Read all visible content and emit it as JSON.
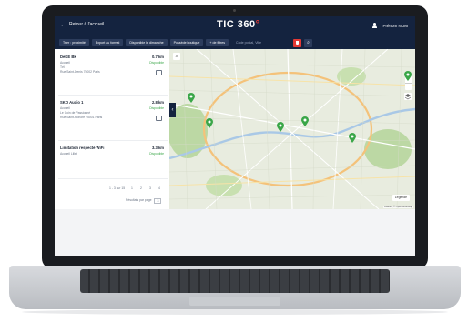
{
  "app": {
    "back_label": "Retour à l'accueil",
    "logo_main": "TIC 360",
    "logo_accent": "°",
    "user_name": "Prénom NOM"
  },
  "toolbar": {
    "buttons": [
      "Trier : proximité",
      "Export au format",
      "Disponible le dimanche",
      "Possède boutique",
      "+ de filtres"
    ],
    "search_placeholder": "Code postal, Ville"
  },
  "list": {
    "items": [
      {
        "title": "DeKE Bk",
        "distance": "0.7 km",
        "line1": "Accueil",
        "line2": "Tél",
        "line3": "Rue Saint-Denis 75002 Paris",
        "status": "Disponible"
      },
      {
        "title": "SKO Audio 1",
        "distance": "2.8 km",
        "line1": "Accueil",
        "line2": "Le Coin de Passionné",
        "line3": "Rue Saint-Honoré 75001 Paris",
        "status": "Disponible"
      },
      {
        "title": "Limitation respecté WiFi",
        "distance": "3.3 km",
        "line1": "Accueil Lillet",
        "line2": "",
        "line3": "",
        "status": "Disponible"
      }
    ],
    "pager_info": "1 - 3 sur 15",
    "pages": [
      "1",
      "2",
      "3",
      "4"
    ],
    "per_page_label": "Résultats par page",
    "per_page_value": "3"
  },
  "map": {
    "legend_label": "Légende",
    "attribution": "Leaflet | © OpenStreetMap",
    "marker_color": "#3aa648"
  },
  "colors": {
    "header": "#14233f",
    "button": "#2c3c5c",
    "accent_red": "#e53935",
    "marker_green": "#3aa648"
  }
}
